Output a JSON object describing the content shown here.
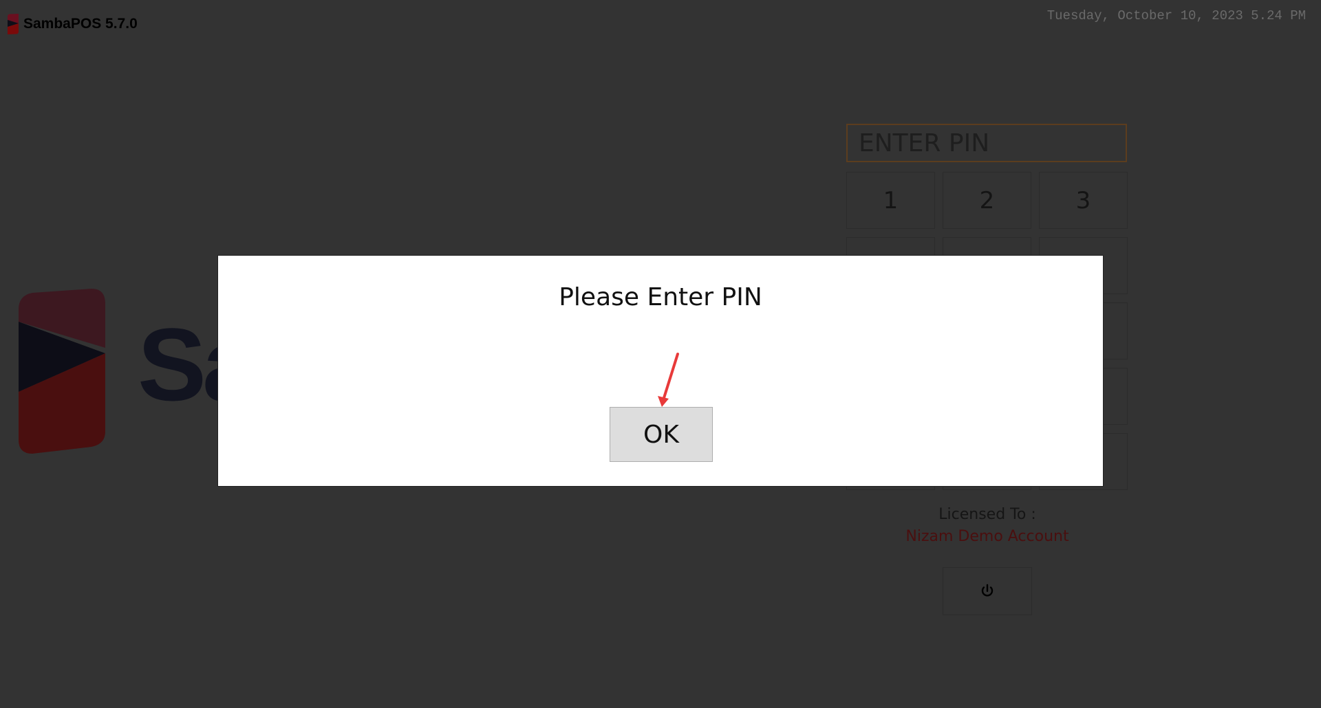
{
  "app": {
    "title": "SambaPOS 5.7.0",
    "datetime": "Tuesday, October 10, 2023 5.24 PM",
    "brand_word": "Sa"
  },
  "pin_pad": {
    "display_placeholder": "ENTER PIN",
    "keys": [
      "1",
      "2",
      "3",
      "",
      "",
      "",
      "",
      "",
      "",
      "",
      "",
      "",
      "",
      "",
      ""
    ]
  },
  "license": {
    "label": "Licensed To :",
    "name": "Nizam Demo Account"
  },
  "power": {
    "icon": "power-icon"
  },
  "dialog": {
    "message": "Please Enter PIN",
    "ok_label": "OK"
  },
  "colors": {
    "background": "#333333",
    "dialog": "#ffffff",
    "ok_button": "#dddddd",
    "license_name": "#4a0f0f",
    "annotation_arrow": "#e83a3a"
  }
}
